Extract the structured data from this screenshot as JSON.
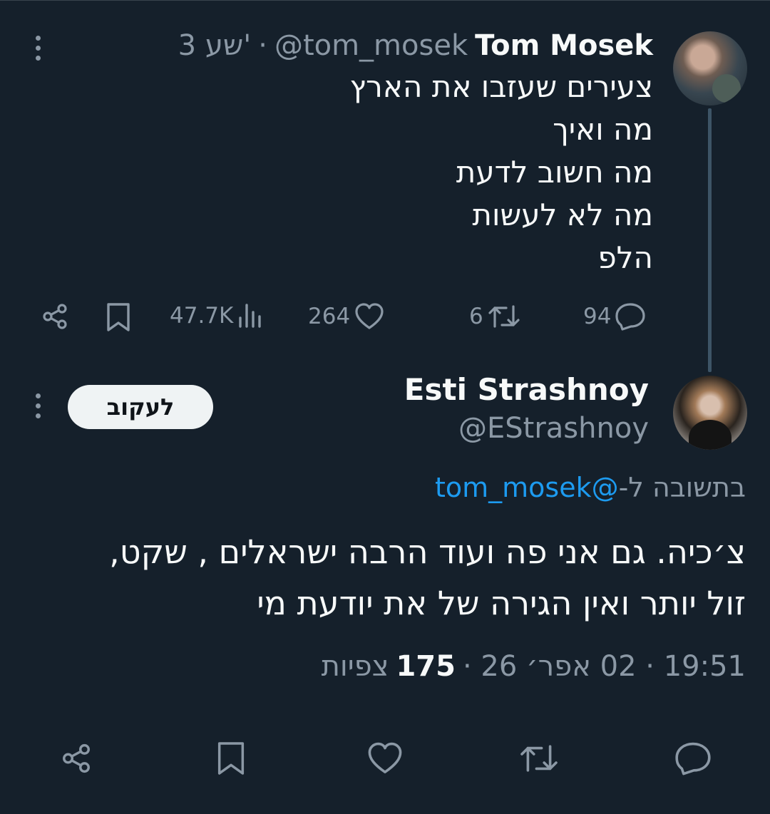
{
  "parent_tweet": {
    "display_name": "Tom Mosek",
    "handle": "@tom_mosek",
    "separator": "·",
    "time_ago": "3 שע'",
    "body_lines": [
      "צעירים שעזבו את הארץ",
      "מה ואיך",
      "מה חשוב לדעת",
      "מה לא לעשות",
      "הלפ"
    ],
    "stats": {
      "replies": "94",
      "reposts": "6",
      "likes": "264",
      "views": "47.7K"
    }
  },
  "main_tweet": {
    "display_name": "Esti Strashnoy",
    "handle": "@EStrashnoy",
    "follow_label": "לעקוב",
    "reply_prefix": "בתשובה ל-",
    "reply_to": "@tom_mosek",
    "body_lines": [
      "צ׳כיה. גם אני פה ועוד הרבה ישראלים , שקט,",
      "זול יותר ואין הגירה של את יודעת מי"
    ],
    "timestamp": "19:51 · 02 אפר׳ 26 ·",
    "views_count": "175",
    "views_label": "צפיות"
  },
  "icons": [
    "reply-icon",
    "repost-icon",
    "like-icon",
    "views-icon",
    "bookmark-icon",
    "share-icon",
    "more-icon"
  ],
  "colors": {
    "background": "#15202b",
    "text": "#f7f9f9",
    "muted": "#8b98a5",
    "link": "#1d9bf0",
    "button_bg": "#eff3f4"
  }
}
